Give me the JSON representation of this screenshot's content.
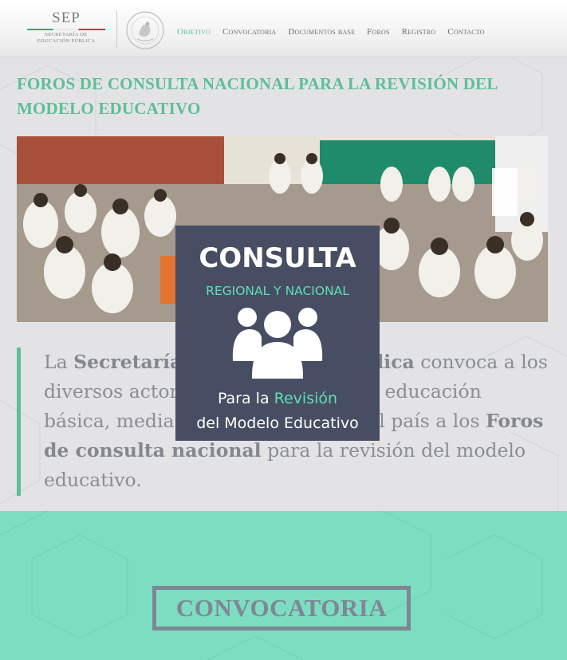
{
  "header": {
    "logo_name": "SEP",
    "logo_subtitle_1": "SECRETARÍA DE",
    "logo_subtitle_2": "EDUCACIÓN PÚBLICA",
    "nav": [
      {
        "label": "Objetivo",
        "active": true
      },
      {
        "label": "Convocatoria",
        "active": false
      },
      {
        "label": "Documentos base",
        "active": false
      },
      {
        "label": "Foros",
        "active": false
      },
      {
        "label": "Registro",
        "active": false
      },
      {
        "label": "Contacto",
        "active": false
      }
    ]
  },
  "main": {
    "title": "FOROS DE CONSULTA NACIONAL PARA LA REVISIÓN DEL MODELO EDUCATIVO",
    "intro": {
      "t1": "La ",
      "b1": "Secretaría de Educación Pública",
      "t2": " convoca a los diversos actores involucrados en la educación básica, media superior y normal del país a los ",
      "b2": "Foros de consulta nacional",
      "t3": " para la revisión del modelo educativo."
    }
  },
  "overlay": {
    "line1": "CONSULTA",
    "line2": "REGIONAL Y NACIONAL",
    "line3_a": "Para la ",
    "line3_b": "Revisión",
    "line4": "del Modelo Educativo"
  },
  "band": {
    "cta_label": "CONVOCATORIA"
  },
  "colors": {
    "accent": "#5cbf98",
    "band": "#7cddc1",
    "overlay_bg": "#474e63",
    "body_text": "#8a8d96",
    "cta": "#7f8696"
  }
}
